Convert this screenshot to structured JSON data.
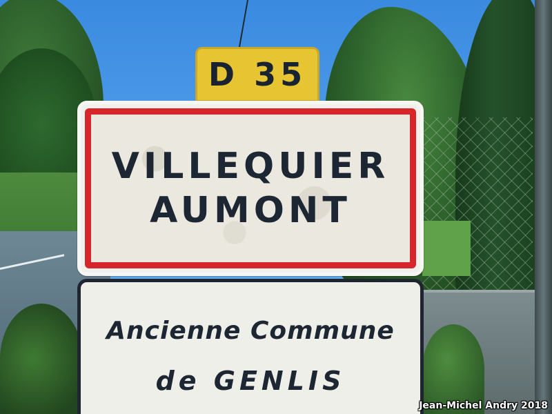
{
  "road_plate": {
    "text": "D 35",
    "color": "#e6c432"
  },
  "town_sign": {
    "lines": [
      "VILLEQUIER",
      "AUMONT"
    ],
    "border_color": "#d6262c"
  },
  "sub_sign": {
    "line1": "Ancienne Commune",
    "line2": "de GENLIS"
  },
  "credit": {
    "text": "Jean-Michel Andry 2018"
  }
}
